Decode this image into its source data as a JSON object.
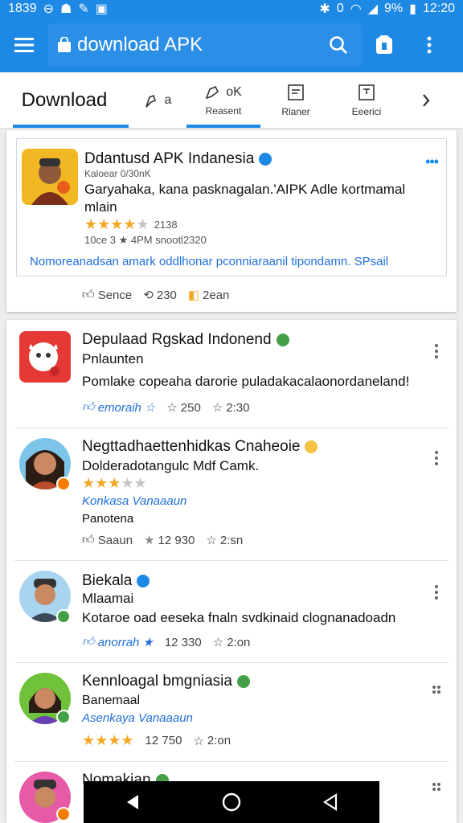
{
  "status_bar": {
    "time_left": "1839",
    "percent": "9%",
    "time_right": "12:20"
  },
  "app_bar": {
    "search_text": "download APK"
  },
  "tabs": [
    {
      "label": "Download"
    },
    {
      "label": "a"
    },
    {
      "label": "oK",
      "sub": "Reasent"
    },
    {
      "label": "",
      "sub": "Rlaner"
    },
    {
      "label": "",
      "sub": "Eeerici"
    }
  ],
  "featured": {
    "title": "Ddantusd APK Indanesia",
    "subtitle": "Kaloear 0/30nK",
    "body": "Garyahaka, kana pasknagalan.'AIPK Adle kortmamal mlain",
    "rating_count": "2138",
    "meta": "10ce 3 ★ 4PM snootl2320",
    "link": "Nomoreanadsan amark oddlhonar pconniaraanil tipondamn. SPsail",
    "stats": {
      "like": "Sence",
      "comments": "230",
      "shares": "2ean"
    }
  },
  "posts": [
    {
      "title": "Depulaad Rgskad Indonend",
      "sub": "Pnlaunten",
      "body": "Pomlake copeaha darorie puladakacalaonordaneland!",
      "link": "emoraih",
      "stat1": "250",
      "stat2": "2:30",
      "stars": 0,
      "sublink": "",
      "extra": ""
    },
    {
      "title": "Negttadhaettenhidkas Cnaheoie",
      "sub": "Dolderadotangulc Mdf Camk.",
      "body": "",
      "link": "",
      "stat1": "12 930",
      "stat2": "2:sn",
      "stars": 3,
      "sublink": "Konkasa Vanaaaun",
      "extra": "Panotena",
      "like": "Saaun"
    },
    {
      "title": "Biekala",
      "sub": "Mlaamai",
      "body": "Kotaroe oad eeseka fnaln svdkinaid clognanadoadn",
      "link": "anorrah",
      "stat1": "12 330",
      "stat2": "2:on",
      "stars": 0,
      "sublink": "",
      "extra": ""
    },
    {
      "title": "Kennloagal bmgniasia",
      "sub": "Banemaal",
      "body": "",
      "link": "",
      "stat1": "12 750",
      "stat2": "2:on",
      "stars": 4,
      "sublink": "Asenkaya Vanaaaun",
      "extra": ""
    },
    {
      "title": "Nomakian",
      "sub": "",
      "body": "",
      "link": "",
      "stat1": "",
      "stat2": "",
      "stars": 0,
      "sublink": "",
      "extra": ""
    }
  ],
  "colors": {
    "accent": "#1e88e5",
    "star": "#f5a623",
    "link": "#1e6fd9",
    "verified_blue": "#1e88e5",
    "verified_green": "#43a047"
  }
}
